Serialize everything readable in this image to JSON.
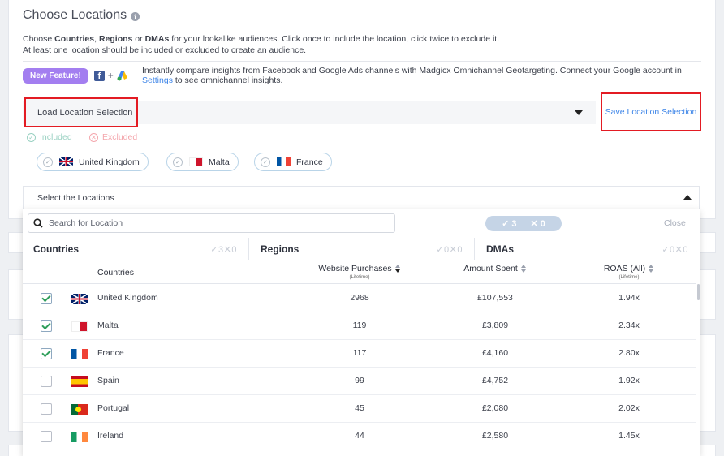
{
  "page": {
    "title": "Choose Locations",
    "description": {
      "prefix": "Choose ",
      "b1": "Countries",
      "sep1": ", ",
      "b2": "Regions",
      "sep2": " or ",
      "b3": "DMAs",
      "suffix": " for your lookalike audiences. Click once to include the location, click twice to exclude it.",
      "line2": "At least one location should be included or excluded to create an audience."
    }
  },
  "feature": {
    "badge": "New Feature!",
    "text": "Instantly compare insights from Facebook and Google Ads channels with Madgicx Omnichannel Geotargeting. Connect your Google account in",
    "link": "Settings",
    "text_after": " to see omnichannel insights."
  },
  "controls": {
    "load_label": "Load Location Selection",
    "save_label": "Save Location Selection",
    "included_label": "Included",
    "excluded_label": "Excluded",
    "select_label": "Select the Locations"
  },
  "chips": [
    {
      "label": "United Kingdom",
      "flag": "uk"
    },
    {
      "label": "Malta",
      "flag": "mt"
    },
    {
      "label": "France",
      "flag": "fr"
    }
  ],
  "dropdown": {
    "search_placeholder": "Search for Location",
    "counter_included": "3",
    "counter_excluded": "0",
    "close_label": "Close",
    "tabs": [
      {
        "label": "Countries",
        "included": "3",
        "excluded": "0"
      },
      {
        "label": "Regions",
        "included": "0",
        "excluded": "0"
      },
      {
        "label": "DMAs",
        "included": "0",
        "excluded": "0"
      }
    ],
    "columns": {
      "name": "Countries",
      "purchases": "Website Purchases",
      "purchases_sub": "(Lifetime)",
      "spent": "Amount Spent",
      "roas": "ROAS (All)",
      "roas_sub": "(Lifetime)"
    },
    "rows": [
      {
        "name": "United Kingdom",
        "flag": "uk",
        "checked": true,
        "purchases": "2968",
        "spent": "£107,553",
        "roas": "1.94x"
      },
      {
        "name": "Malta",
        "flag": "mt",
        "checked": true,
        "purchases": "119",
        "spent": "£3,809",
        "roas": "2.34x"
      },
      {
        "name": "France",
        "flag": "fr",
        "checked": true,
        "purchases": "117",
        "spent": "£4,160",
        "roas": "2.80x"
      },
      {
        "name": "Spain",
        "flag": "es",
        "checked": false,
        "purchases": "99",
        "spent": "£4,752",
        "roas": "1.92x"
      },
      {
        "name": "Portugal",
        "flag": "pt",
        "checked": false,
        "purchases": "45",
        "spent": "£2,080",
        "roas": "2.02x"
      },
      {
        "name": "Ireland",
        "flag": "ie",
        "checked": false,
        "purchases": "44",
        "spent": "£2,580",
        "roas": "1.45x"
      }
    ]
  },
  "colors": {
    "accent_red": "#e31b23",
    "link_blue": "#3f86e8",
    "badge_purple": "#a37ef0",
    "included_green": "#9ad1c2",
    "excluded_pink": "#f4a8ae"
  }
}
